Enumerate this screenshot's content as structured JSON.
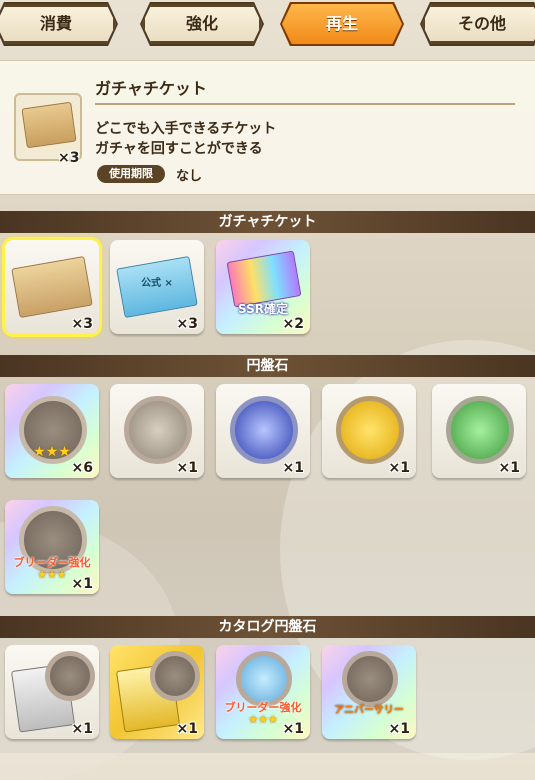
{
  "tabs": [
    {
      "label": "消費",
      "active": false
    },
    {
      "label": "強化",
      "active": false
    },
    {
      "label": "再生",
      "active": true
    },
    {
      "label": "その他",
      "active": false
    }
  ],
  "selected_item": {
    "name": "ガチャチケット",
    "quantity": "×3",
    "desc_line1": "どこでも入手できるチケット",
    "desc_line2": "ガチャを回すことができる",
    "expiry_label": "使用期限",
    "expiry_value": "なし"
  },
  "sections": {
    "gacha_tickets": {
      "title": "ガチャチケット",
      "items": [
        {
          "kind": "ticket-gold",
          "qty": "×3",
          "selected": true
        },
        {
          "kind": "ticket-blue",
          "qty": "×3",
          "ticket_text": "公式 ×"
        },
        {
          "kind": "ticket-ssr",
          "qty": "×2",
          "label": "SSR確定"
        }
      ]
    },
    "disc_stones": {
      "title": "円盤石",
      "items": [
        {
          "kind": "disc-rainbow",
          "qty": "×6",
          "stars": "★★★"
        },
        {
          "kind": "disc-grey",
          "qty": "×1"
        },
        {
          "kind": "disc-blue",
          "qty": "×1"
        },
        {
          "kind": "disc-yellow",
          "qty": "×1"
        },
        {
          "kind": "disc-green",
          "qty": "×1"
        },
        {
          "kind": "disc-breeder",
          "qty": "×1",
          "label": "ブリーダー強化",
          "stars": "★★★"
        }
      ]
    },
    "catalog_discs": {
      "title": "カタログ円盤石",
      "items": [
        {
          "kind": "catalog-silver",
          "qty": "×1"
        },
        {
          "kind": "catalog-gold",
          "qty": "×1"
        },
        {
          "kind": "catalog-breeder",
          "qty": "×1",
          "label": "ブリーダー強化",
          "stars": "★★★"
        },
        {
          "kind": "catalog-anniversary",
          "qty": "×1",
          "label": "アニバーサリー"
        }
      ]
    }
  },
  "colors": {
    "active_tab": "#f5941f",
    "section_bar": "#5b4226",
    "selection": "#fff04a"
  }
}
